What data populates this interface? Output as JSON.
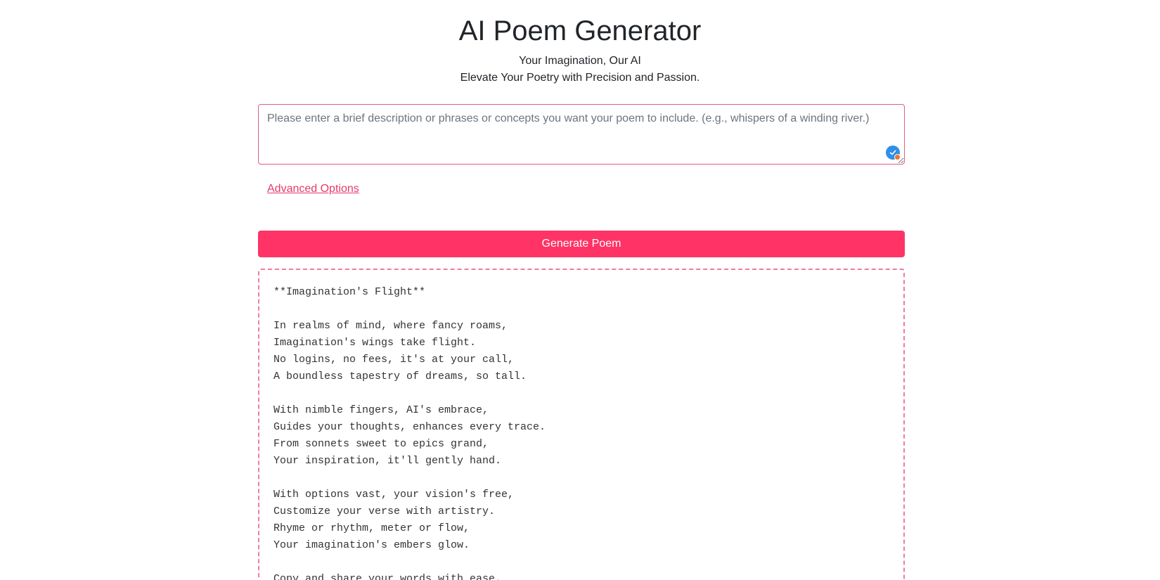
{
  "header": {
    "title": "AI Poem Generator",
    "subtitle_line1": "Your Imagination, Our AI",
    "subtitle_line2": "Elevate Your Poetry with Precision and Passion."
  },
  "prompt": {
    "value": "",
    "placeholder": "Please enter a brief description or phrases or concepts you want your poem to include. (e.g., whispers of a winding river.)"
  },
  "advanced_options": {
    "label": "Advanced Options"
  },
  "actions": {
    "generate_label": "Generate Poem"
  },
  "poem": {
    "text": "**Imagination's Flight**\n\nIn realms of mind, where fancy roams,\nImagination's wings take flight.\nNo logins, no fees, it's at your call,\nA boundless tapestry of dreams, so tall.\n\nWith nimble fingers, AI's embrace,\nGuides your thoughts, enhances every trace.\nFrom sonnets sweet to epics grand,\nYour inspiration, it'll gently hand.\n\nWith options vast, your vision's free,\nCustomize your verse with artistry.\nRhyme or rhythm, meter or flow,\nYour imagination's embers glow.\n\nCopy and share your words with ease,"
  },
  "colors": {
    "accent": "#ff3366",
    "link": "#e63a69",
    "dashed_border": "#f07ba0",
    "grammar_badge": "#2f8fe8"
  },
  "icons": {
    "grammar_check": "grammar-check-icon"
  }
}
